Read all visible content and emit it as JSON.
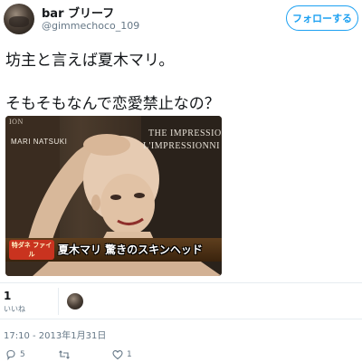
{
  "user": {
    "display_name": "bar ブリーフ",
    "handle": "@gimmechoco_109",
    "follow_label": "フォローする"
  },
  "tweet": {
    "line1": "坊主と言えば夏木マリ。",
    "line2": "そもそもなんで恋愛禁止なの？"
  },
  "media": {
    "overlay_name": "MARI NATSUKI",
    "overlay_brand_1": "THE IMPRESSION",
    "overlay_brand_2": "L'IMPRESSIONNI",
    "overlay_corner": "ION",
    "badge": "特ダネ ファイル",
    "caption": "夏木マリ 驚きのスキンヘッド"
  },
  "stats": {
    "likes_count": "1",
    "likes_label": "いいね"
  },
  "timestamp": "17:10 - 2013年1月31日",
  "actions": {
    "reply_count": "5",
    "retweet_count": "",
    "like_count": "1"
  },
  "colors": {
    "accent": "#1da1f2",
    "text": "#14171a",
    "muted": "#657786",
    "divider": "#e6ecf0"
  }
}
